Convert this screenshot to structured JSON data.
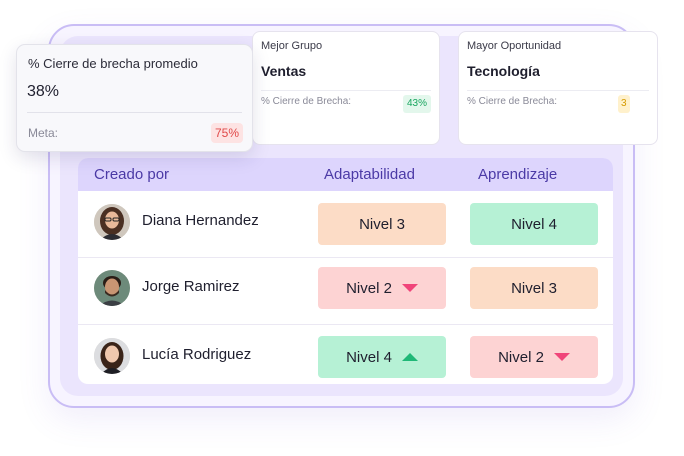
{
  "overlay_card": {
    "label": "% Cierre de brecha promedio",
    "value": "38%",
    "sub_label": "Meta:",
    "badge": "75%"
  },
  "stat_cards": [
    {
      "label": "Mejor Grupo",
      "value": "Ventas",
      "sub_label": "% Cierre de Brecha:",
      "badge": "43%"
    },
    {
      "label": "Mayor Oportunidad",
      "value": "Tecnología",
      "sub_label": "% Cierre de Brecha:",
      "badge": "3"
    }
  ],
  "table": {
    "headers": [
      "Creado por",
      "Adaptabilidad",
      "Aprendizaje"
    ],
    "rows": [
      {
        "name": "Diana Hernandez",
        "adaptabilidad": {
          "label": "Nivel 3",
          "color": "#fcdcc6",
          "trend": "none"
        },
        "aprendizaje": {
          "label": "Nivel 4",
          "color": "#b6f1d5",
          "trend": "none"
        }
      },
      {
        "name": "Jorge Ramirez",
        "adaptabilidad": {
          "label": "Nivel 2",
          "color": "#fdd3d3",
          "trend": "down"
        },
        "aprendizaje": {
          "label": "Nivel 3",
          "color": "#fcdcc6",
          "trend": "none"
        }
      },
      {
        "name": "Lucía Rodriguez",
        "adaptabilidad": {
          "label": "Nivel 4",
          "color": "#b6f1d5",
          "trend": "up"
        },
        "aprendizaje": {
          "label": "Nivel 2",
          "color": "#fdd3d3",
          "trend": "down"
        }
      }
    ]
  },
  "colors": {
    "frame_border": "#c9bdf5",
    "header_bg": "#ddd5fd",
    "header_text": "#4b3aa6",
    "trend_down": "#f0457a",
    "trend_up": "#1fb877"
  }
}
